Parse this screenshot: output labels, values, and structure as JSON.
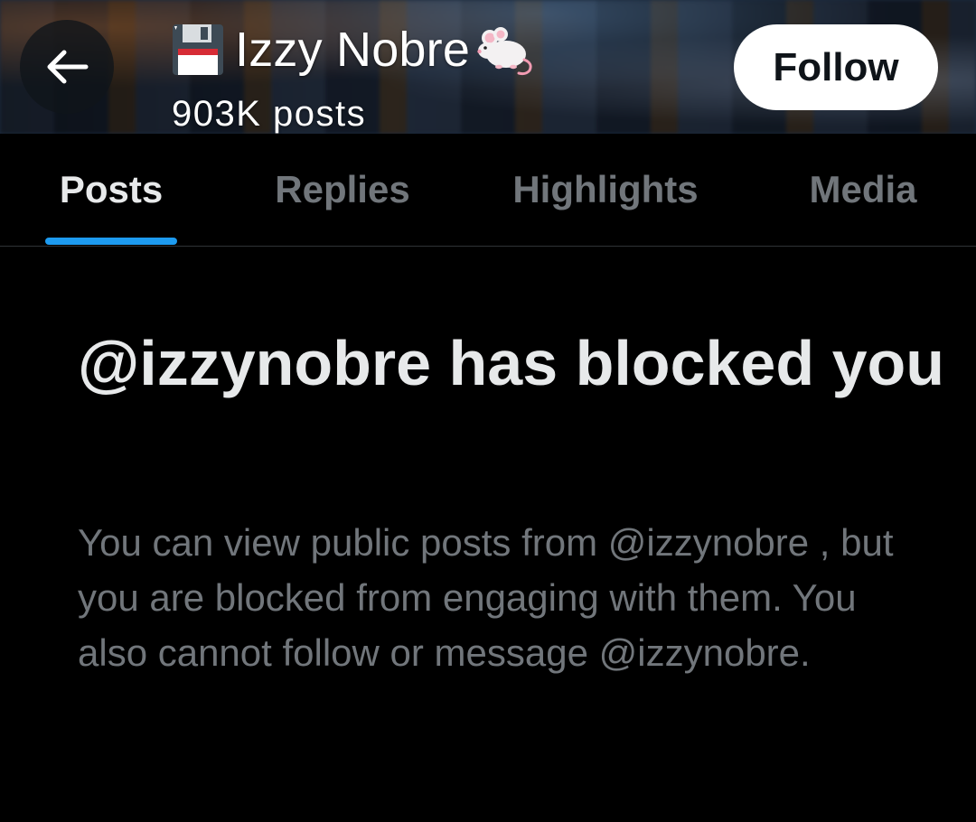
{
  "header": {
    "back_icon": "arrow-left-icon",
    "name_emoji_prefix_icon": "floppy-disk-icon",
    "name": "Izzy Nobre",
    "name_emoji_suffix_icon": "mouse-icon",
    "post_count": "903K posts",
    "follow_label": "Follow"
  },
  "tabs": [
    {
      "label": "Posts",
      "active": true
    },
    {
      "label": "Replies",
      "active": false
    },
    {
      "label": "Highlights",
      "active": false
    },
    {
      "label": "Media",
      "active": false
    }
  ],
  "blocked": {
    "title": "@izzynobre has blocked you",
    "body": "You can view public posts from @izzynobre , but you are blocked from engaging with them. You also cannot follow or message @izzynobre."
  },
  "colors": {
    "background": "#000000",
    "primary_text": "#e7e9ea",
    "secondary_text": "#71767b",
    "accent": "#1d9bf0",
    "follow_button_bg": "#ffffff",
    "follow_button_text": "#0f1419",
    "divider": "#2f3336"
  }
}
